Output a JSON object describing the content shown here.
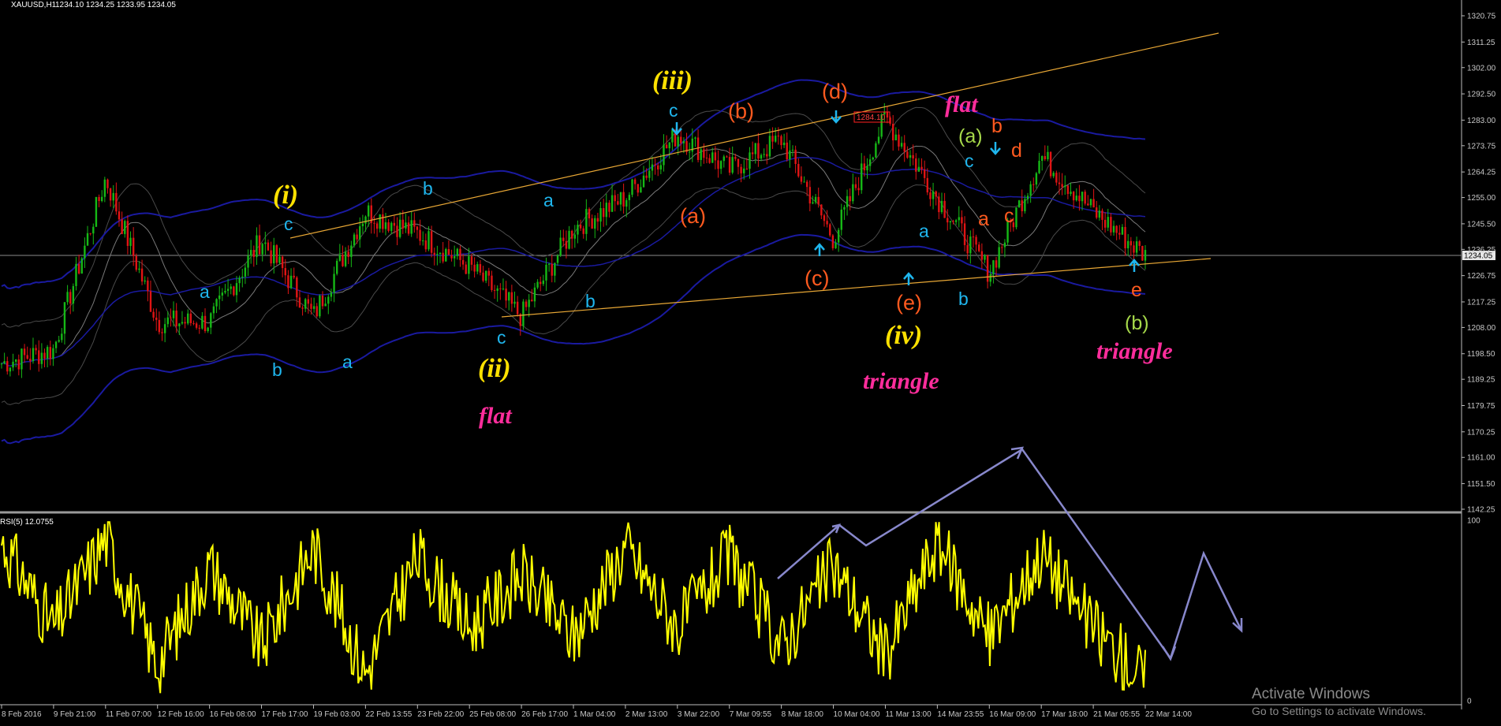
{
  "header": {
    "symbol": "XAUUSD,H1",
    "ohlc": "1234.10 1234.25 1233.95 1234.05",
    "rsi_label": "RSI(5) 12.0755"
  },
  "price_label": "1234.05",
  "price_tag_d": "1284.10",
  "watermark": {
    "line1": "Activate Windows",
    "line2": "Go to Settings to activate Windows."
  },
  "colors": {
    "background": "#000000",
    "axis": "#bdbdbd",
    "trendline": "#e8a735",
    "rsi": "#ffff00",
    "bollinger": "#1a1aa0",
    "ma": "#7a7a7a",
    "annotation_arrow": "#8888cc",
    "cyan": "#1fb6ee",
    "orange": "#ff5a1f",
    "yellow": "#ffe100",
    "magenta": "#ff2d9c",
    "green": "#a6d94a",
    "bull": "#16b816",
    "bear": "#e01414"
  },
  "chart_data": [
    {
      "type": "line",
      "subtype": "candlestick-price",
      "symbol": "XAUUSD",
      "timeframe": "H1",
      "ylim": [
        1142.25,
        1320.75
      ],
      "y_ticks": [
        "1320.75",
        "1311.25",
        "1302.00",
        "1292.50",
        "1283.00",
        "1273.75",
        "1264.25",
        "1255.00",
        "1245.50",
        "1236.25",
        "1226.75",
        "1217.25",
        "1208.00",
        "1198.50",
        "1189.25",
        "1179.75",
        "1170.25",
        "1161.00",
        "1151.50",
        "1142.25"
      ],
      "x_ticks": [
        "8 Feb 2016",
        "9 Feb 21:00",
        "11 Feb 07:00",
        "12 Feb 16:00",
        "16 Feb 08:00",
        "17 Feb 17:00",
        "19 Feb 03:00",
        "22 Feb 13:55",
        "23 Feb 22:00",
        "25 Feb 08:00",
        "26 Feb 17:00",
        "1 Mar 04:00",
        "2 Mar 13:00",
        "3 Mar 22:00",
        "7 Mar 09:55",
        "8 Mar 18:00",
        "10 Mar 04:00",
        "11 Mar 13:00",
        "14 Mar 23:55",
        "16 Mar 09:00",
        "17 Mar 18:00",
        "21 Mar 05:55",
        "22 Mar 14:00"
      ],
      "last_price": 1234.05,
      "x": [
        0,
        1,
        2,
        3,
        4,
        5,
        6,
        7,
        8,
        9,
        10,
        11,
        12,
        13,
        14,
        15,
        16,
        17,
        18,
        19,
        20,
        21,
        22
      ],
      "series": [
        {
          "values": [
            1195,
            1200,
            1262,
            1210,
            1210,
            1240,
            1212,
            1250,
            1242,
            1230,
            1212,
            1244,
            1255,
            1278,
            1265,
            1276,
            1240,
            1284,
            1255,
            1228,
            1270,
            1250,
            1234
          ]
        }
      ],
      "annotations": [
        {
          "text": "(i)",
          "color": "yellow",
          "style": "italic"
        },
        {
          "text": "(ii)",
          "color": "yellow",
          "style": "italic"
        },
        {
          "text": "(iii)",
          "color": "yellow",
          "style": "italic"
        },
        {
          "text": "(iv)",
          "color": "yellow",
          "style": "italic"
        },
        {
          "text": "flat",
          "color": "magenta",
          "style": "italic"
        },
        {
          "text": "flat",
          "color": "magenta",
          "style": "italic"
        },
        {
          "text": "triangle",
          "color": "magenta",
          "style": "italic"
        },
        {
          "text": "triangle",
          "color": "magenta",
          "style": "italic"
        },
        {
          "text": "(a)",
          "color": "orange"
        },
        {
          "text": "(b)",
          "color": "orange"
        },
        {
          "text": "(c)",
          "color": "orange"
        },
        {
          "text": "(d)",
          "color": "orange"
        },
        {
          "text": "(e)",
          "color": "orange"
        },
        {
          "text": "(a)",
          "color": "green"
        },
        {
          "text": "(b)",
          "color": "green"
        },
        {
          "text": "a",
          "color": "cyan"
        },
        {
          "text": "b",
          "color": "cyan"
        },
        {
          "text": "c",
          "color": "cyan"
        },
        {
          "text": "a",
          "color": "orange"
        },
        {
          "text": "b",
          "color": "orange"
        },
        {
          "text": "c",
          "color": "orange"
        },
        {
          "text": "d",
          "color": "orange"
        },
        {
          "text": "e",
          "color": "orange"
        }
      ]
    },
    {
      "type": "line",
      "subtype": "RSI",
      "period": 5,
      "current_value": 12.0755,
      "ylim": [
        0,
        100
      ],
      "y_ticks": [
        "100",
        "0"
      ],
      "x": [
        0,
        1,
        2,
        3,
        4,
        5,
        6,
        7,
        8,
        9,
        10,
        11,
        12,
        13,
        14,
        15,
        16,
        17,
        18,
        19,
        20,
        21,
        22
      ],
      "series": [
        {
          "values": [
            88,
            40,
            90,
            20,
            75,
            30,
            85,
            15,
            80,
            40,
            70,
            35,
            85,
            40,
            80,
            30,
            75,
            25,
            88,
            35,
            82,
            40,
            12
          ]
        }
      ]
    }
  ]
}
